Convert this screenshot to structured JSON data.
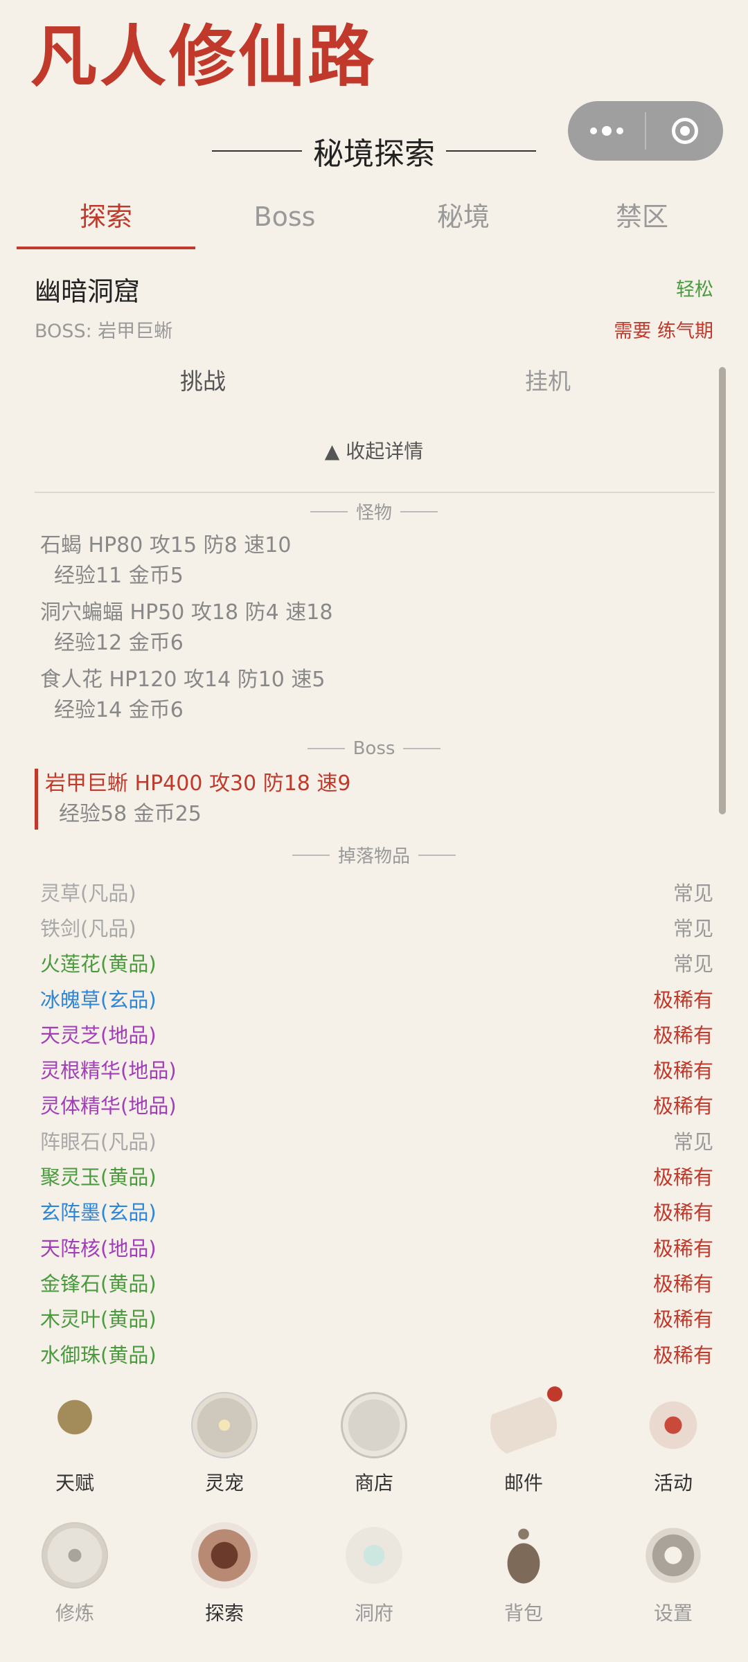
{
  "app_title": "凡人修仙路",
  "section_title": "秘境探索",
  "tabs": [
    {
      "label": "探索",
      "active": true
    },
    {
      "label": "Boss",
      "active": false
    },
    {
      "label": "秘境",
      "active": false
    },
    {
      "label": "禁区",
      "active": false
    }
  ],
  "dungeon": {
    "name": "幽暗洞窟",
    "difficulty": "轻松",
    "boss_text": "BOSS: 岩甲巨蜥",
    "requirement": "需要 练气期"
  },
  "actions": {
    "challenge": "挑战",
    "idle": "挂机"
  },
  "collapse_label": "▲ 收起详情",
  "monsters_heading": "怪物",
  "monsters": [
    {
      "stats": "石蝎  HP80 攻15 防8 速10",
      "reward": "经验11 金币5"
    },
    {
      "stats": "洞穴蝙蝠  HP50 攻18 防4 速18",
      "reward": "经验12 金币6"
    },
    {
      "stats": "食人花  HP120 攻14 防10 速5",
      "reward": "经验14 金币6"
    }
  ],
  "boss_heading": "Boss",
  "boss": {
    "stats": "岩甲巨蜥  HP400 攻30 防18 速9",
    "reward": "经验58 金币25"
  },
  "drops_heading": "掉落物品",
  "drops": [
    {
      "name": "灵草(凡品)",
      "rarity": "常见",
      "color": "#a8a8a8"
    },
    {
      "name": "铁剑(凡品)",
      "rarity": "常见",
      "color": "#a8a8a8"
    },
    {
      "name": "火莲花(黄品)",
      "rarity": "常见",
      "color": "#4a9a3e"
    },
    {
      "name": "冰魄草(玄品)",
      "rarity": "极稀有",
      "color": "#2f86d6"
    },
    {
      "name": "天灵芝(地品)",
      "rarity": "极稀有",
      "color": "#a23db8"
    },
    {
      "name": "灵根精华(地品)",
      "rarity": "极稀有",
      "color": "#a23db8"
    },
    {
      "name": "灵体精华(地品)",
      "rarity": "极稀有",
      "color": "#a23db8"
    },
    {
      "name": "阵眼石(凡品)",
      "rarity": "常见",
      "color": "#a8a8a8"
    },
    {
      "name": "聚灵玉(黄品)",
      "rarity": "极稀有",
      "color": "#4a9a3e"
    },
    {
      "name": "玄阵墨(玄品)",
      "rarity": "极稀有",
      "color": "#2f86d6"
    },
    {
      "name": "天阵核(地品)",
      "rarity": "极稀有",
      "color": "#a23db8"
    },
    {
      "name": "金锋石(黄品)",
      "rarity": "极稀有",
      "color": "#4a9a3e"
    },
    {
      "name": "木灵叶(黄品)",
      "rarity": "极稀有",
      "color": "#4a9a3e"
    },
    {
      "name": "水御珠(黄品)",
      "rarity": "极稀有",
      "color": "#4a9a3e"
    }
  ],
  "nav_row1": [
    {
      "label": "天赋",
      "icon": "tree-icon"
    },
    {
      "label": "灵宠",
      "icon": "spirit-pet-icon"
    },
    {
      "label": "商店",
      "icon": "shop-icon"
    },
    {
      "label": "邮件",
      "icon": "mail-icon"
    },
    {
      "label": "活动",
      "icon": "event-icon"
    }
  ],
  "nav_row2": [
    {
      "label": "修炼",
      "icon": "cultivation-icon"
    },
    {
      "label": "探索",
      "icon": "explore-icon"
    },
    {
      "label": "洞府",
      "icon": "cave-dwelling-icon"
    },
    {
      "label": "背包",
      "icon": "bag-icon"
    },
    {
      "label": "设置",
      "icon": "settings-icon"
    }
  ],
  "colors": {
    "accent": "#c0392b",
    "background": "#f5f0e8",
    "easy": "#4a9a3e"
  }
}
